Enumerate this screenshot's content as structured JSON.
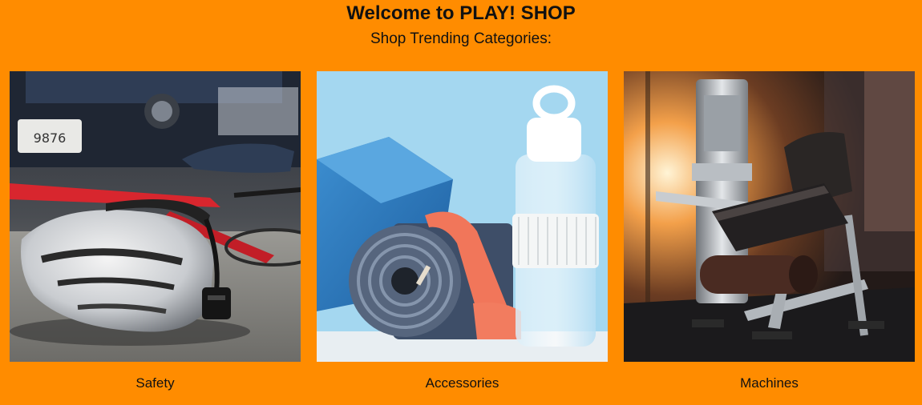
{
  "header": {
    "title": "Welcome to PLAY! SHOP",
    "subtitle": "Shop Trending Categories:"
  },
  "categories": [
    {
      "label": "Safety",
      "image": "helmet-on-road-image"
    },
    {
      "label": "Accessories",
      "image": "yoga-mat-bottle-image"
    },
    {
      "label": "Machines",
      "image": "gym-machine-image"
    }
  ],
  "colors": {
    "background": "#FF8C00",
    "text": "#111111"
  }
}
